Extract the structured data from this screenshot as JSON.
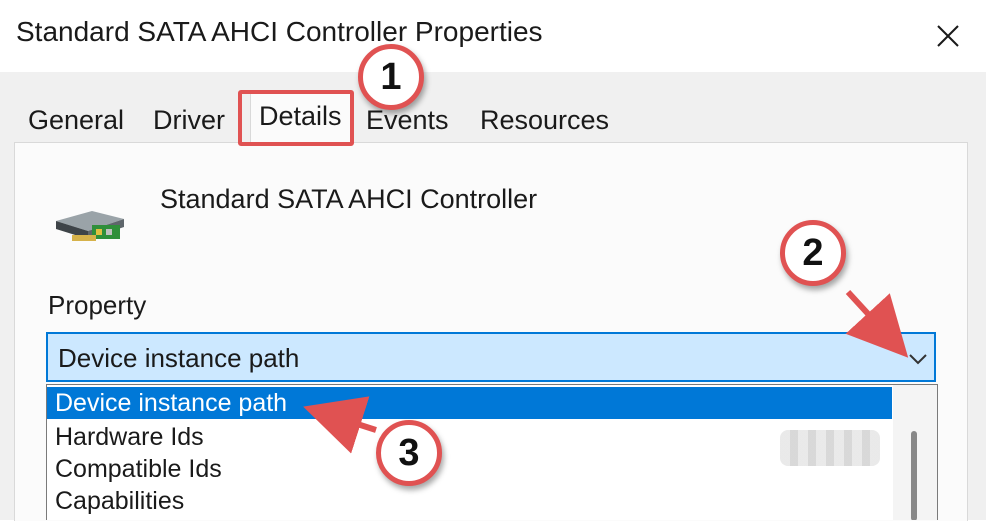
{
  "window": {
    "title": "Standard SATA AHCI Controller Properties",
    "close_icon": "close-icon"
  },
  "tabs": [
    {
      "label": "General"
    },
    {
      "label": "Driver"
    },
    {
      "label": "Details",
      "active": true
    },
    {
      "label": "Events"
    },
    {
      "label": "Resources"
    }
  ],
  "device": {
    "name": "Standard SATA AHCI Controller",
    "icon": "controller-card-icon"
  },
  "property": {
    "label": "Property",
    "selected": "Device instance path",
    "dropdown_icon": "chevron-down-icon"
  },
  "dropdown_options": [
    {
      "label": "Device instance path",
      "selected": true
    },
    {
      "label": "Hardware Ids"
    },
    {
      "label": "Compatible Ids"
    },
    {
      "label": "Capabilities"
    }
  ],
  "annotations": {
    "badge1": "1",
    "badge2": "2",
    "badge3": "3",
    "color": "#e05252"
  },
  "colors": {
    "accent": "#0078d7",
    "select_bg": "#cce8ff",
    "dialog_bg": "#f0f0f0"
  }
}
